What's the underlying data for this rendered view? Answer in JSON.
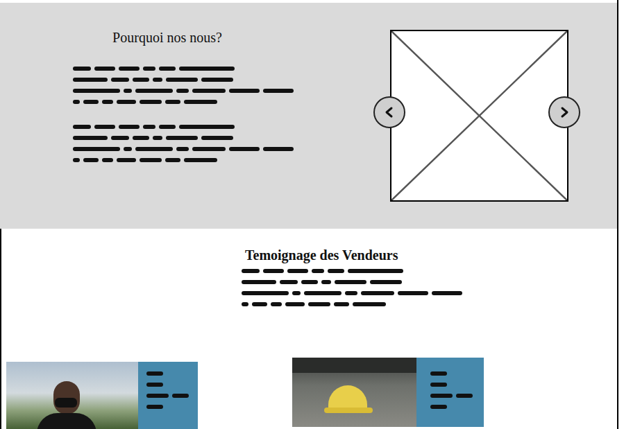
{
  "why": {
    "title": "Pourquoi nos nous?"
  },
  "testimonials": {
    "title": "Temoignage des Vendeurs"
  }
}
